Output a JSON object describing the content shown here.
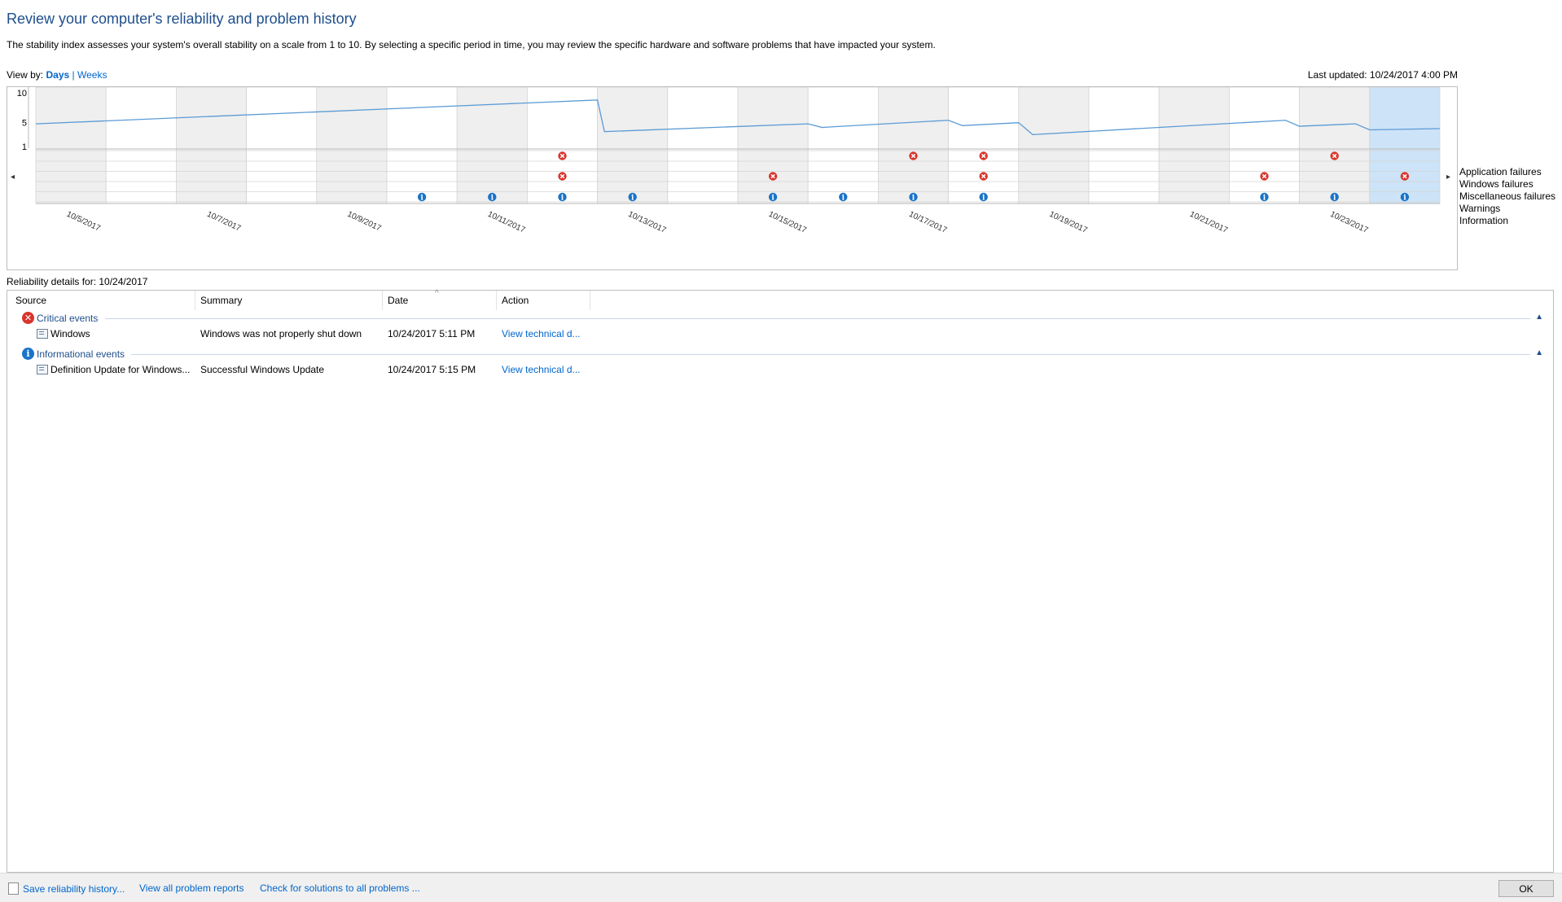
{
  "page": {
    "title": "Review your computer's reliability and problem history",
    "description": "The stability index assesses your system's overall stability on a scale from 1 to 10. By selecting a specific period in time, you may review the specific hardware and software problems that have impacted your system.",
    "view_by_label": "View by:",
    "view_days": "Days",
    "view_sep": "|",
    "view_weeks": "Weeks",
    "last_updated": "Last updated: 10/24/2017 4:00 PM"
  },
  "chart_data": {
    "type": "line",
    "y_ticks": [
      "10",
      "5",
      "1"
    ],
    "ylim": [
      1,
      10
    ],
    "days": 20,
    "selected_day_index": 19,
    "date_labels": [
      "10/5/2017",
      "10/7/2017",
      "10/9/2017",
      "10/11/2017",
      "10/13/2017",
      "10/15/2017",
      "10/17/2017",
      "10/19/2017",
      "10/21/2017",
      "10/23/2017"
    ],
    "date_label_day_index": [
      0,
      2,
      4,
      6,
      8,
      10,
      12,
      14,
      16,
      18
    ],
    "stability_series": [
      {
        "x": 0,
        "y": 4.8
      },
      {
        "x": 8.0,
        "y": 8.8
      },
      {
        "x": 8.1,
        "y": 3.5
      },
      {
        "x": 11.0,
        "y": 4.8
      },
      {
        "x": 11.2,
        "y": 4.2
      },
      {
        "x": 13.0,
        "y": 5.4
      },
      {
        "x": 13.2,
        "y": 4.5
      },
      {
        "x": 14.0,
        "y": 5.0
      },
      {
        "x": 14.2,
        "y": 3.0
      },
      {
        "x": 17.8,
        "y": 5.4
      },
      {
        "x": 18.0,
        "y": 4.4
      },
      {
        "x": 18.8,
        "y": 4.8
      },
      {
        "x": 19.0,
        "y": 3.8
      },
      {
        "x": 20.0,
        "y": 4.0
      }
    ],
    "rows": [
      "Application failures",
      "Windows failures",
      "Miscellaneous failures",
      "Warnings",
      "Information"
    ],
    "events": {
      "application_failures": [
        7,
        12,
        13,
        18
      ],
      "windows_failures": [],
      "miscellaneous_failures": [
        7,
        10,
        13,
        17,
        19
      ],
      "warnings": [],
      "information": [
        5,
        6,
        7,
        8,
        10,
        11,
        12,
        13,
        17,
        18,
        19
      ]
    },
    "colors": {
      "line": "#5b9bd5",
      "error": "#d9342b",
      "info": "#1a73c8",
      "shade": "#efefef",
      "selected": "#cde3f7"
    }
  },
  "details": {
    "label": "Reliability details for: 10/24/2017",
    "columns": [
      "Source",
      "Summary",
      "Date",
      "Action"
    ],
    "groups": [
      {
        "name": "Critical events",
        "icon": "error-icon",
        "rows": [
          {
            "source": "Windows",
            "summary": "Windows was not properly shut down",
            "date": "10/24/2017 5:11 PM",
            "action": "View  technical d..."
          }
        ]
      },
      {
        "name": "Informational events",
        "icon": "info-icon",
        "rows": [
          {
            "source": "Definition Update for Windows...",
            "summary": "Successful Windows Update",
            "date": "10/24/2017 5:15 PM",
            "action": "View  technical d..."
          }
        ]
      }
    ]
  },
  "footer": {
    "save": "Save reliability history...",
    "view_all": "View all problem reports",
    "check": "Check for solutions to all problems ...",
    "ok": "OK"
  }
}
